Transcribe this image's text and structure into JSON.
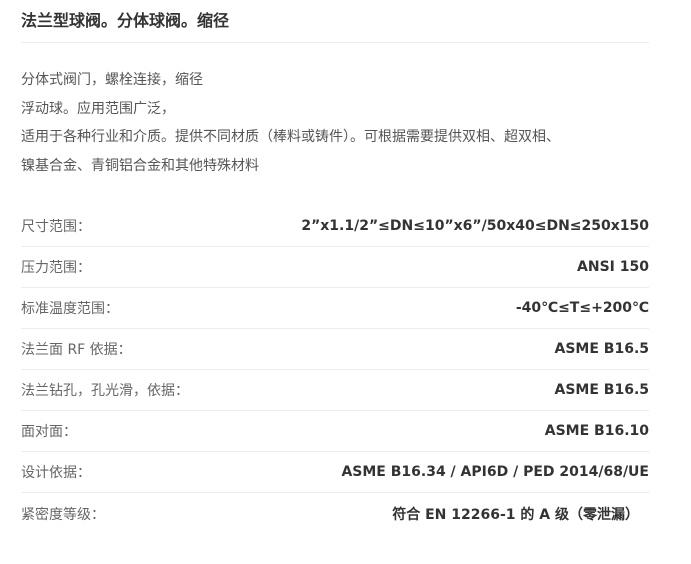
{
  "title": "法兰型球阀。分体球阀。缩径",
  "description": [
    "分体式阀门，螺栓连接，缩径",
    "浮动球。应用范围广泛，",
    "适用于各种行业和介质。提供不同材质（棒料或铸件）。可根据需要提供双相、超双相、",
    "镍基合金、青铜铝合金和其他特殊材料"
  ],
  "specs": [
    {
      "label": "尺寸范围：",
      "value": "2”x1.1/2”≤DN≤10”x6”/50x40≤DN≤250x150"
    },
    {
      "label": "压力范围：",
      "value": "ANSI 150"
    },
    {
      "label": "标准温度范围：",
      "value": "-40℃≤T≤+200℃"
    },
    {
      "label": "法兰面 RF 依据：",
      "value": "ASME B16.5"
    },
    {
      "label": "法兰钻孔，孔光滑，依据：",
      "value": "ASME B16.5"
    },
    {
      "label": "面对面：",
      "value": "ASME B16.10"
    },
    {
      "label": "设计依据：",
      "value": "ASME B16.34 / API6D / PED 2014/68/UE"
    },
    {
      "label": "紧密度等级：",
      "value": "符合 EN 12266-1 的 A 级（零泄漏）"
    }
  ]
}
